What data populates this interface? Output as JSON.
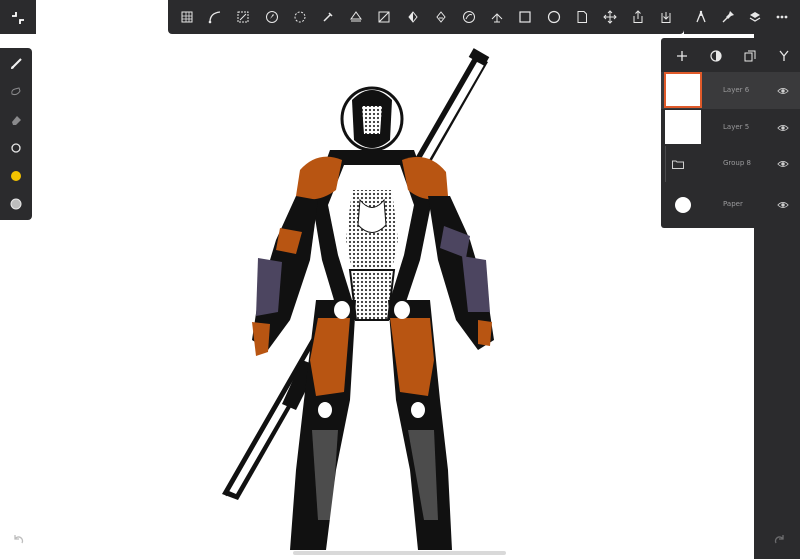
{
  "toolbar": {
    "icons": [
      "grid-icon",
      "curve-icon",
      "transform-icon",
      "compass-icon",
      "lasso-select-icon",
      "eyedropper-icon",
      "fill-icon",
      "slash-box-icon",
      "fill-drop-icon",
      "drop-icon",
      "globe-icon",
      "perspective-icon",
      "rectangle-icon",
      "circle-icon",
      "document-icon",
      "move-icon",
      "share-icon",
      "import-icon"
    ]
  },
  "top_right": {
    "icons": [
      "pen-nib-icon",
      "pin-icon",
      "layers-icon",
      "more-icon"
    ]
  },
  "left_panel": {
    "icons": [
      "brush-icon",
      "smudge-icon",
      "eraser-icon",
      "size-circle-icon",
      "color-swatch-icon",
      "opacity-circle-icon"
    ],
    "color": "#f5c400"
  },
  "layers": {
    "header_icons": [
      "add-layer-icon",
      "blend-icon",
      "duplicate-icon",
      "merge-icon"
    ],
    "rows": [
      {
        "name": "Layer 6",
        "selected": true
      },
      {
        "name": "Layer 5",
        "selected": false
      },
      {
        "name": "Group 8",
        "selected": false
      },
      {
        "name": "Paper",
        "selected": false
      }
    ]
  },
  "colors": {
    "panel": "#2b2b2d",
    "accent": "#e05a2a",
    "armor_orange": "#b85512",
    "armor_purple": "#4c4560"
  }
}
